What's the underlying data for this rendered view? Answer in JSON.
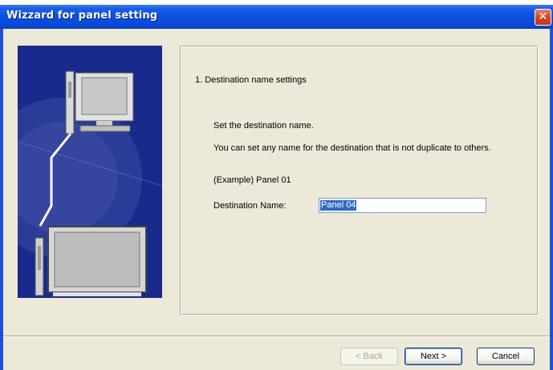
{
  "window": {
    "title": "Wizzard for panel setting",
    "close_glyph": "✕"
  },
  "content": {
    "step_title": "1. Destination name settings",
    "instruction": "Set the destination name.",
    "description": "You can set any name for the destination that is not duplicate to others.",
    "example": "(Example) Panel 01",
    "field_label": "Destination Name:",
    "field_value": "Panel 04"
  },
  "buttons": {
    "back": "< Back",
    "next": "Next >",
    "cancel": "Cancel"
  },
  "icons": {
    "close": "close-icon",
    "illustration": "computer-to-panel-illustration"
  },
  "colors": {
    "titlebar": "#0b4fe0",
    "dialog_bg": "#ece9d8",
    "illustration_bg": "#1a2a8c",
    "selection": "#316ac5",
    "close_button": "#d2451f"
  }
}
